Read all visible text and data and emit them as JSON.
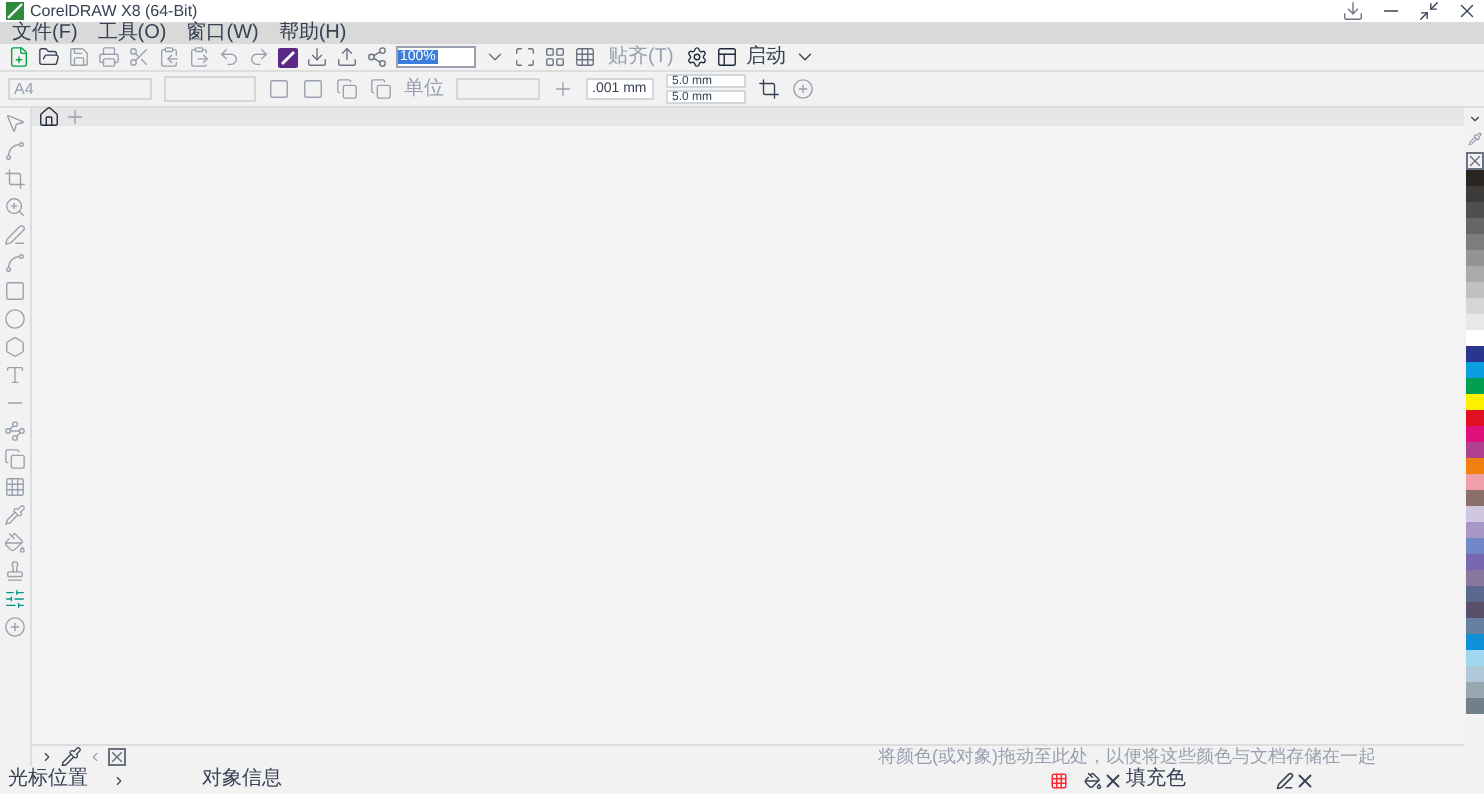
{
  "window": {
    "title": "CorelDRAW X8 (64-Bit)"
  },
  "menus": [
    "文件(F)",
    "工具(O)",
    "窗口(W)",
    "帮助(H)"
  ],
  "toolbar": {
    "zoom": "100%",
    "snap": "贴齐(T)",
    "launch": "启动"
  },
  "property_bar": {
    "page_size": "A4",
    "units_label": "单位",
    "nudge": ".001 mm",
    "duplicate_x": "5.0 mm",
    "duplicate_y": "5.0 mm"
  },
  "palette": [
    {
      "color": "#2b2522"
    },
    {
      "color": "#3d3a3a"
    },
    {
      "color": "#4f4f4f"
    },
    {
      "color": "#666666"
    },
    {
      "color": "#7d7d7d"
    },
    {
      "color": "#949494"
    },
    {
      "color": "#aaaaaa"
    },
    {
      "color": "#c0c0c0"
    },
    {
      "color": "#d6d6d6"
    },
    {
      "color": "#e8e8e8"
    },
    {
      "color": "#ffffff"
    },
    {
      "color": "#2a3590"
    },
    {
      "color": "#0aa0e0"
    },
    {
      "color": "#00a050"
    },
    {
      "color": "#fff000"
    },
    {
      "color": "#e01020"
    },
    {
      "color": "#e0107a"
    },
    {
      "color": "#b04090"
    },
    {
      "color": "#f08010"
    },
    {
      "color": "#f0a0a8"
    },
    {
      "color": "#8a7068"
    },
    {
      "color": "#d0c8e0"
    },
    {
      "color": "#a898c8"
    },
    {
      "color": "#7088c8"
    },
    {
      "color": "#7868b0"
    },
    {
      "color": "#8878a0"
    },
    {
      "color": "#5a6890"
    },
    {
      "color": "#585068"
    },
    {
      "color": "#6880a0"
    },
    {
      "color": "#1090d8"
    },
    {
      "color": "#a0d8f0"
    },
    {
      "color": "#b0c8d8"
    },
    {
      "color": "#98a8b0"
    },
    {
      "color": "#708088"
    }
  ],
  "document_palette": {
    "hint": "将颜色(或对象)拖动至此处，以便将这些颜色与文档存储在一起"
  },
  "status_bar": {
    "cursor_position": "光标位置",
    "object_info": "对象信息",
    "fill": "填充色"
  }
}
